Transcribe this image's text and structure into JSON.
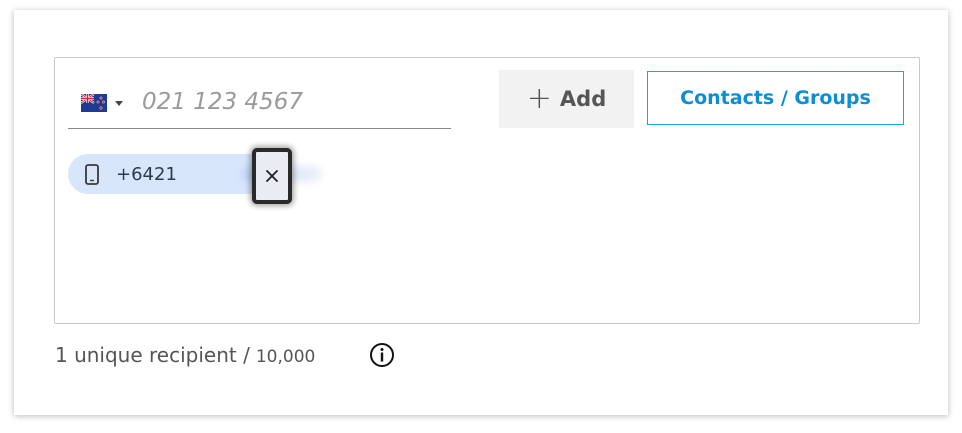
{
  "recipient_input": {
    "country_flag": "new-zealand-flag-icon",
    "placeholder": "021 123 4567",
    "value": ""
  },
  "buttons": {
    "add_icon": "plus-icon",
    "add_label": "Add",
    "contacts_label": "Contacts / Groups"
  },
  "recipients": [
    {
      "icon": "mobile-phone-icon",
      "number_visible": "+6421",
      "remove_icon": "close-icon"
    }
  ],
  "summary": {
    "count_text": "1 unique recipient /",
    "max_text": "10,000",
    "info_icon": "info-icon"
  },
  "colors": {
    "accent": "#0c8ed6",
    "accent_border": "#1fa3d9",
    "chip_bg": "#d7e6fb",
    "add_bg": "#f2f2f2"
  }
}
